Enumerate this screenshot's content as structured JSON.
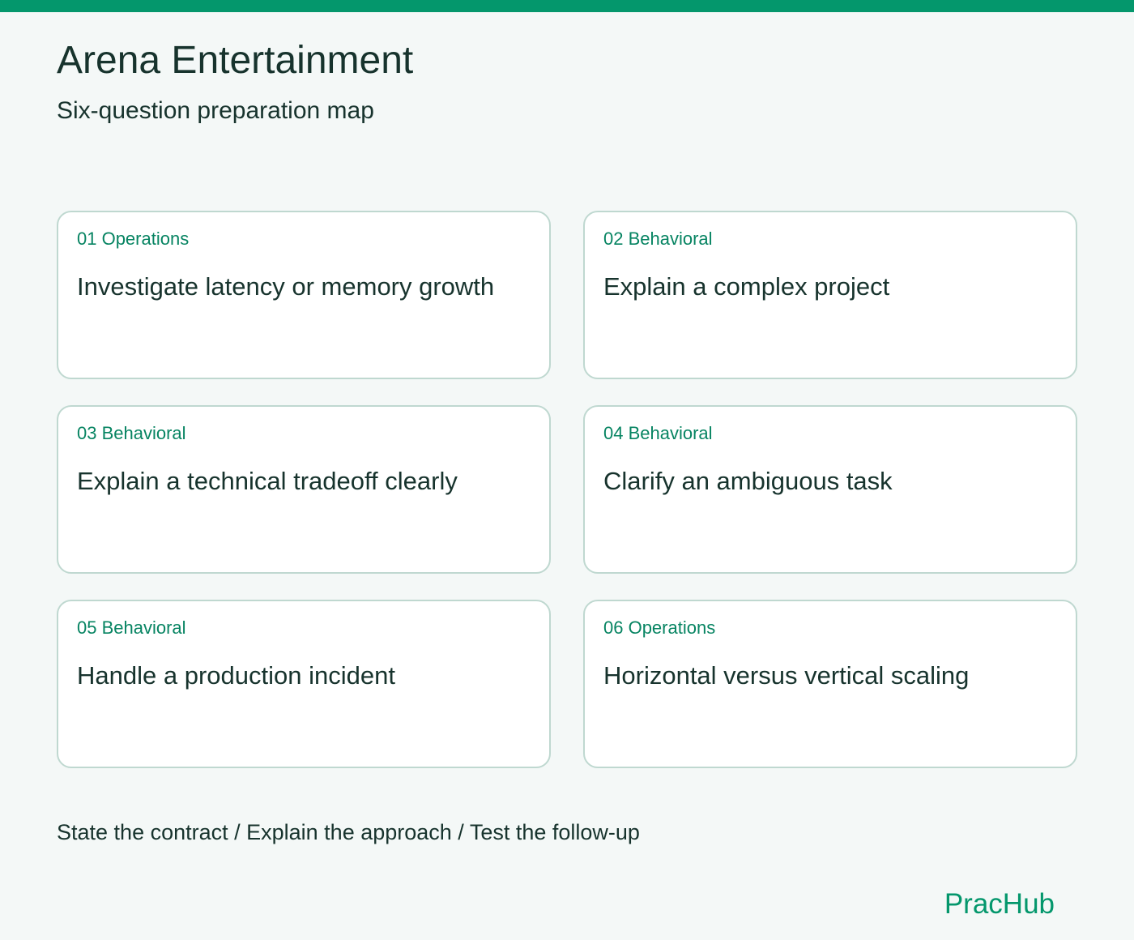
{
  "header": {
    "title": "Arena Entertainment",
    "subtitle": "Six-question preparation map"
  },
  "cards": [
    {
      "label": "01 Operations",
      "title": "Investigate latency or memory growth"
    },
    {
      "label": "02 Behavioral",
      "title": "Explain a complex project"
    },
    {
      "label": "03 Behavioral",
      "title": "Explain a technical tradeoff clearly"
    },
    {
      "label": "04 Behavioral",
      "title": "Clarify an ambiguous task"
    },
    {
      "label": "05 Behavioral",
      "title": "Handle a production incident"
    },
    {
      "label": "06 Operations",
      "title": "Horizontal versus vertical scaling"
    }
  ],
  "footer": {
    "note": "State the contract / Explain the approach / Test the follow-up",
    "brand": "PracHub"
  },
  "colors": {
    "accent": "#04976c",
    "label": "#078462",
    "text": "#17332d",
    "border": "#bfd8d0",
    "background": "#f4f8f7"
  }
}
